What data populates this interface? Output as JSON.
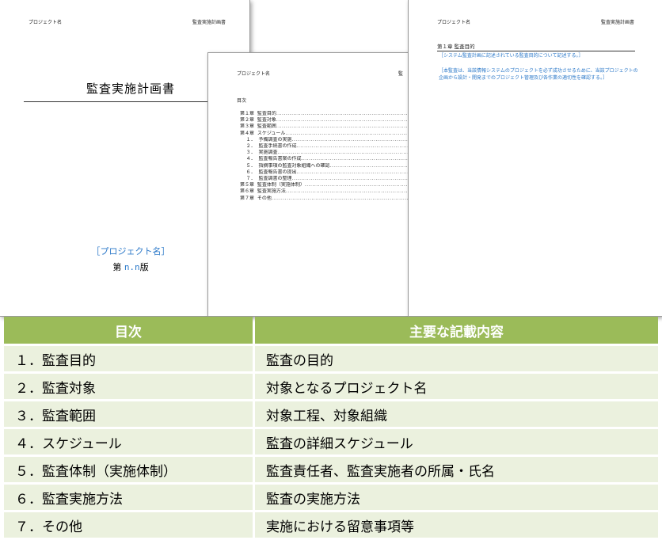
{
  "cover": {
    "header_left": "プロジェクト名",
    "header_right": "監査実施計画書",
    "title": "監査実施計画書",
    "project_name": "［プロジェクト名］",
    "edition_prefix": "第 ",
    "edition_number": "n.n",
    "edition_suffix": "版"
  },
  "toc_page": {
    "header_left": "プロジェクト名",
    "header_right": "監",
    "heading": "目次",
    "leader": "........................................................................................................",
    "lines": [
      "第１章  監査目的",
      "第２章  監査対象",
      "第３章  監査範囲",
      "第４章  スケジュール",
      "    １．  予備調査の実施",
      "    ２．  監査手続書の作成",
      "    ３．  実施調査",
      "    ４．  監査報告書案の作成",
      "    ５．  指摘事項の監査対象組織への確認",
      "    ６．  監査報告書の提出",
      "    ７．  監査調書の整理",
      "第５章  監査体制（実施体制）",
      "第６章  監査実施方法",
      "第７章  その他"
    ]
  },
  "chapter_page": {
    "header_left": "プロジェクト名",
    "header_right": "監査実施計画書",
    "heading": "第１章   監査目的",
    "note1": "［システム監査計画に記述されている監査目的について記述する。］",
    "note2": "［本監査は、当該情報システムのプロジェクトを必ず成功させるために、当該プロジェクトの企画から設計・開発までのプロジェクト管理及び各作業の適切性を確認する。］"
  },
  "table": {
    "headers": [
      "目次",
      "主要な記載内容"
    ],
    "rows": [
      [
        "１．監査目的",
        "監査の目的"
      ],
      [
        "２．監査対象",
        "対象となるプロジェクト名"
      ],
      [
        "３．監査範囲",
        "対象工程、対象組織"
      ],
      [
        "４．スケジュール",
        "監査の詳細スケジュール"
      ],
      [
        "５．監査体制（実施体制）",
        "監査責任者、監査実施者の所属・氏名"
      ],
      [
        "６．監査実施方法",
        "監査の実施方法"
      ],
      [
        "７．その他",
        "実施における留意事項等"
      ]
    ]
  },
  "colors": {
    "header_green": "#9bbb59",
    "row_green": "#ebf1de",
    "placeholder_blue": "#2c79c9"
  }
}
